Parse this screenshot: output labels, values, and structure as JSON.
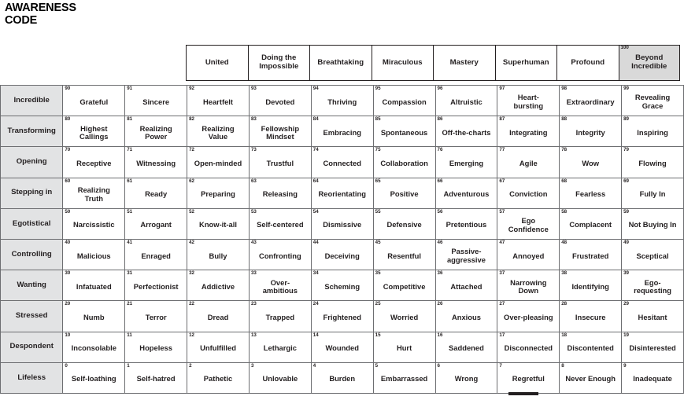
{
  "title": "AWARENESS\nCODE",
  "columns": [
    {
      "label": "United",
      "number": ""
    },
    {
      "label": "Doing the\nImpossible",
      "number": ""
    },
    {
      "label": "Breathtaking",
      "number": ""
    },
    {
      "label": "Miraculous",
      "number": ""
    },
    {
      "label": "Mastery",
      "number": ""
    },
    {
      "label": "Superhuman",
      "number": ""
    },
    {
      "label": "Profound",
      "number": ""
    },
    {
      "label": "Beyond\nIncredible",
      "number": "100",
      "shaded": true
    }
  ],
  "colors": {
    "header_shaded_bg": "#d9d9d9",
    "row_label_bg": "#e2e3e4",
    "grid_line": "#6d6e71",
    "header_border": "#231f20",
    "text": "#231f20",
    "page_bg": "#ffffff",
    "marker": "#231f20"
  },
  "rows": [
    {
      "label": "Incredible",
      "cells": [
        {
          "number": "90",
          "text": "Grateful"
        },
        {
          "number": "91",
          "text": "Sincere"
        },
        {
          "number": "92",
          "text": "Heartfelt"
        },
        {
          "number": "93",
          "text": "Devoted"
        },
        {
          "number": "94",
          "text": "Thriving"
        },
        {
          "number": "95",
          "text": "Compassion"
        },
        {
          "number": "96",
          "text": "Altruistic"
        },
        {
          "number": "97",
          "text": "Heart-\nbursting"
        },
        {
          "number": "98",
          "text": "Extraordinary"
        },
        {
          "number": "99",
          "text": "Revealing\nGrace"
        }
      ]
    },
    {
      "label": "Transforming",
      "cells": [
        {
          "number": "80",
          "text": "Highest\nCallings"
        },
        {
          "number": "81",
          "text": "Realizing\nPower"
        },
        {
          "number": "82",
          "text": "Realizing\nValue"
        },
        {
          "number": "83",
          "text": "Fellowship\nMindset"
        },
        {
          "number": "84",
          "text": "Embracing"
        },
        {
          "number": "85",
          "text": "Spontaneous"
        },
        {
          "number": "86",
          "text": "Off-the-charts"
        },
        {
          "number": "87",
          "text": "Integrating"
        },
        {
          "number": "88",
          "text": "Integrity"
        },
        {
          "number": "89",
          "text": "Inspiring"
        }
      ]
    },
    {
      "label": "Opening",
      "cells": [
        {
          "number": "70",
          "text": "Receptive"
        },
        {
          "number": "71",
          "text": "Witnessing"
        },
        {
          "number": "72",
          "text": "Open-minded"
        },
        {
          "number": "73",
          "text": "Trustful"
        },
        {
          "number": "74",
          "text": "Connected"
        },
        {
          "number": "75",
          "text": "Collaboration"
        },
        {
          "number": "76",
          "text": "Emerging"
        },
        {
          "number": "77",
          "text": "Agile"
        },
        {
          "number": "78",
          "text": "Wow"
        },
        {
          "number": "79",
          "text": "Flowing"
        }
      ]
    },
    {
      "label": "Stepping in",
      "cells": [
        {
          "number": "60",
          "text": "Realizing\nTruth"
        },
        {
          "number": "61",
          "text": "Ready"
        },
        {
          "number": "62",
          "text": "Preparing"
        },
        {
          "number": "63",
          "text": "Releasing"
        },
        {
          "number": "64",
          "text": "Reorientating"
        },
        {
          "number": "65",
          "text": "Positive"
        },
        {
          "number": "66",
          "text": "Adventurous"
        },
        {
          "number": "67",
          "text": "Conviction"
        },
        {
          "number": "68",
          "text": "Fearless"
        },
        {
          "number": "69",
          "text": "Fully In"
        }
      ]
    },
    {
      "label": "Egotistical",
      "cells": [
        {
          "number": "50",
          "text": "Narcissistic"
        },
        {
          "number": "51",
          "text": "Arrogant"
        },
        {
          "number": "52",
          "text": "Know-it-all"
        },
        {
          "number": "53",
          "text": "Self-centered"
        },
        {
          "number": "54",
          "text": "Dismissive"
        },
        {
          "number": "55",
          "text": "Defensive"
        },
        {
          "number": "56",
          "text": "Pretentious"
        },
        {
          "number": "57",
          "text": "Ego\nConfidence"
        },
        {
          "number": "58",
          "text": "Complacent"
        },
        {
          "number": "59",
          "text": "Not Buying In"
        }
      ]
    },
    {
      "label": "Controlling",
      "cells": [
        {
          "number": "40",
          "text": "Malicious"
        },
        {
          "number": "41",
          "text": "Enraged"
        },
        {
          "number": "42",
          "text": "Bully"
        },
        {
          "number": "43",
          "text": "Confronting"
        },
        {
          "number": "44",
          "text": "Deceiving"
        },
        {
          "number": "45",
          "text": "Resentful"
        },
        {
          "number": "46",
          "text": "Passive-\naggressive"
        },
        {
          "number": "47",
          "text": "Annoyed"
        },
        {
          "number": "48",
          "text": "Frustrated"
        },
        {
          "number": "49",
          "text": "Sceptical"
        }
      ]
    },
    {
      "label": "Wanting",
      "cells": [
        {
          "number": "30",
          "text": "Infatuated"
        },
        {
          "number": "31",
          "text": "Perfectionist"
        },
        {
          "number": "32",
          "text": "Addictive"
        },
        {
          "number": "33",
          "text": "Over-\nambitious"
        },
        {
          "number": "34",
          "text": "Scheming"
        },
        {
          "number": "35",
          "text": "Competitive"
        },
        {
          "number": "36",
          "text": "Attached"
        },
        {
          "number": "37",
          "text": "Narrowing\nDown"
        },
        {
          "number": "38",
          "text": "Identifying"
        },
        {
          "number": "39",
          "text": "Ego-\nrequesting"
        }
      ]
    },
    {
      "label": "Stressed",
      "cells": [
        {
          "number": "20",
          "text": "Numb"
        },
        {
          "number": "21",
          "text": "Terror"
        },
        {
          "number": "22",
          "text": "Dread"
        },
        {
          "number": "23",
          "text": "Trapped"
        },
        {
          "number": "24",
          "text": "Frightened"
        },
        {
          "number": "25",
          "text": "Worried"
        },
        {
          "number": "26",
          "text": "Anxious"
        },
        {
          "number": "27",
          "text": "Over-pleasing"
        },
        {
          "number": "28",
          "text": "Insecure"
        },
        {
          "number": "29",
          "text": "Hesitant"
        }
      ]
    },
    {
      "label": "Despondent",
      "cells": [
        {
          "number": "10",
          "text": "Inconsolable"
        },
        {
          "number": "11",
          "text": "Hopeless"
        },
        {
          "number": "12",
          "text": "Unfulfilled"
        },
        {
          "number": "13",
          "text": "Lethargic"
        },
        {
          "number": "14",
          "text": "Wounded"
        },
        {
          "number": "15",
          "text": "Hurt"
        },
        {
          "number": "16",
          "text": "Saddened"
        },
        {
          "number": "17",
          "text": "Disconnected"
        },
        {
          "number": "18",
          "text": "Discontented"
        },
        {
          "number": "19",
          "text": "Disinterested"
        }
      ]
    },
    {
      "label": "Lifeless",
      "cells": [
        {
          "number": "0",
          "text": "Self-loathing"
        },
        {
          "number": "1",
          "text": "Self-hatred"
        },
        {
          "number": "2",
          "text": "Pathetic"
        },
        {
          "number": "3",
          "text": "Unlovable"
        },
        {
          "number": "4",
          "text": "Burden"
        },
        {
          "number": "5",
          "text": "Embarrassed"
        },
        {
          "number": "6",
          "text": "Wrong"
        },
        {
          "number": "7",
          "text": "Regretful"
        },
        {
          "number": "8",
          "text": "Never Enough"
        },
        {
          "number": "9",
          "text": "Inadequate"
        }
      ]
    }
  ]
}
